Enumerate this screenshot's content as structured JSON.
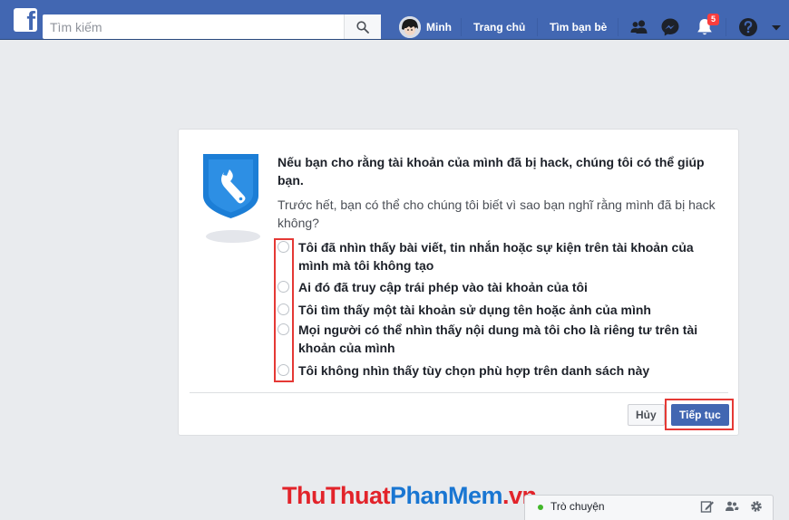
{
  "header": {
    "logo": "f",
    "search": {
      "placeholder": "Tìm kiếm",
      "value": ""
    },
    "user_name": "Minh",
    "nav_home": "Trang chủ",
    "nav_find_friends": "Tìm bạn bè",
    "notification_count": "5",
    "icons": [
      "search-icon",
      "friend-requests-icon",
      "messenger-icon",
      "notifications-icon",
      "help-icon",
      "dropdown-caret-icon"
    ],
    "brand_color": "#4267b2"
  },
  "dialog": {
    "heading": "Nếu bạn cho rằng tài khoản của mình đã bị hack, chúng tôi có thể giúp bạn.",
    "subtext": "Trước hết, bạn có thể cho chúng tôi biết vì sao bạn nghĩ rằng mình đã bị hack không?",
    "options": [
      {
        "label": "Tôi đã nhìn thấy bài viết, tin nhắn hoặc sự kiện trên tài khoản của mình mà tôi không tạo",
        "selected": false
      },
      {
        "label": "Ai đó đã truy cập trái phép vào tài khoản của tôi",
        "selected": false
      },
      {
        "label": "Tôi tìm thấy một tài khoản sử dụng tên hoặc ảnh của mình",
        "selected": false
      },
      {
        "label": "Mọi người có thể nhìn thấy nội dung mà tôi cho là riêng tư trên tài khoản của mình",
        "selected": false
      },
      {
        "label": "Tôi không nhìn thấy tùy chọn phù hợp trên danh sách này",
        "selected": false
      }
    ],
    "cancel_label": "Hủy",
    "continue_label": "Tiếp tục",
    "highlight_color": "#e53935"
  },
  "watermark": {
    "part1": "ThuThuat",
    "part2": "PhanMem",
    "part3": ".vn"
  },
  "chat": {
    "label": "Trò chuyện",
    "icons": [
      "compose-icon",
      "group-icon",
      "settings-icon"
    ]
  }
}
